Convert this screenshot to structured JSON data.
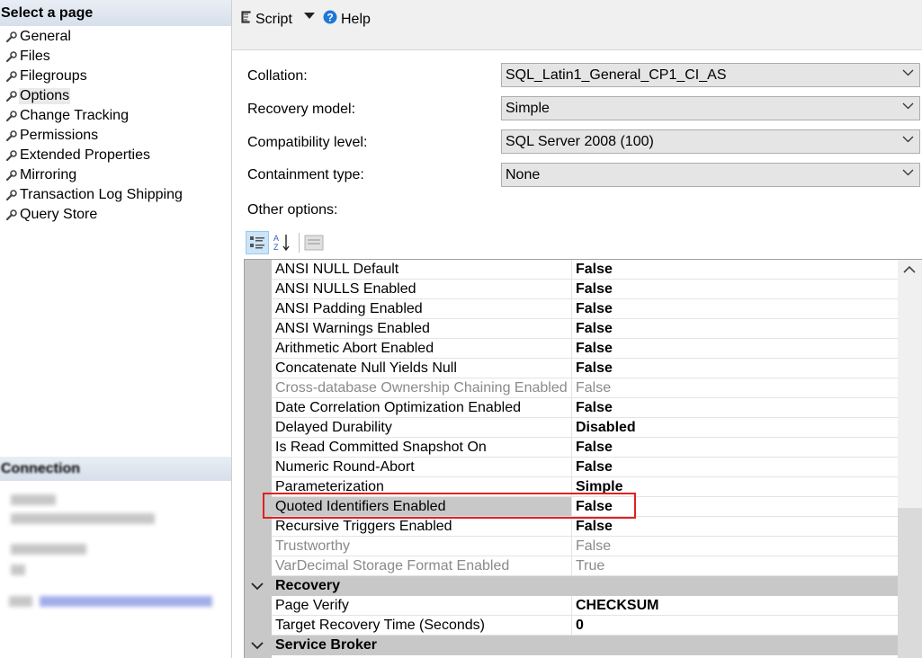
{
  "left_pane": {
    "header": "Select a page",
    "pages": [
      {
        "label": "General"
      },
      {
        "label": "Files"
      },
      {
        "label": "Filegroups"
      },
      {
        "label": "Options",
        "selected": true
      },
      {
        "label": "Change Tracking"
      },
      {
        "label": "Permissions"
      },
      {
        "label": "Extended Properties"
      },
      {
        "label": "Mirroring"
      },
      {
        "label": "Transaction Log Shipping"
      },
      {
        "label": "Query Store"
      }
    ],
    "connection_header": "Connection"
  },
  "toolbar": {
    "script_label": "Script",
    "help_label": "Help"
  },
  "form": {
    "collation_label": "Collation:",
    "collation_value": "SQL_Latin1_General_CP1_CI_AS",
    "recovery_label": "Recovery model:",
    "recovery_value": "Simple",
    "compat_label": "Compatibility level:",
    "compat_value": "SQL Server 2008 (100)",
    "containment_label": "Containment type:",
    "containment_value": "None",
    "other_options_label": "Other options:"
  },
  "grid": {
    "rows": [
      {
        "name": "ANSI NULL Default",
        "value": "False"
      },
      {
        "name": "ANSI NULLS Enabled",
        "value": "False"
      },
      {
        "name": "ANSI Padding Enabled",
        "value": "False"
      },
      {
        "name": "ANSI Warnings Enabled",
        "value": "False"
      },
      {
        "name": "Arithmetic Abort Enabled",
        "value": "False"
      },
      {
        "name": "Concatenate Null Yields Null",
        "value": "False"
      },
      {
        "name": "Cross-database Ownership Chaining Enabled",
        "value": "False",
        "disabled": true
      },
      {
        "name": "Date Correlation Optimization Enabled",
        "value": "False"
      },
      {
        "name": "Delayed Durability",
        "value": "Disabled"
      },
      {
        "name": "Is Read Committed Snapshot On",
        "value": "False"
      },
      {
        "name": "Numeric Round-Abort",
        "value": "False"
      },
      {
        "name": "Parameterization",
        "value": "Simple"
      },
      {
        "name": "Quoted Identifiers Enabled",
        "value": "False",
        "selected": true
      },
      {
        "name": "Recursive Triggers Enabled",
        "value": "False"
      },
      {
        "name": "Trustworthy",
        "value": "False",
        "disabled": true
      },
      {
        "name": "VarDecimal Storage Format Enabled",
        "value": "True",
        "disabled": true
      },
      {
        "category": "Recovery"
      },
      {
        "name": "Page Verify",
        "value": "CHECKSUM"
      },
      {
        "name": "Target Recovery Time (Seconds)",
        "value": "0"
      },
      {
        "category": "Service Broker"
      }
    ]
  },
  "colors": {
    "highlight_border": "#e02020",
    "category_bg": "#c8c8c8",
    "help_icon": "#1e78d7"
  }
}
